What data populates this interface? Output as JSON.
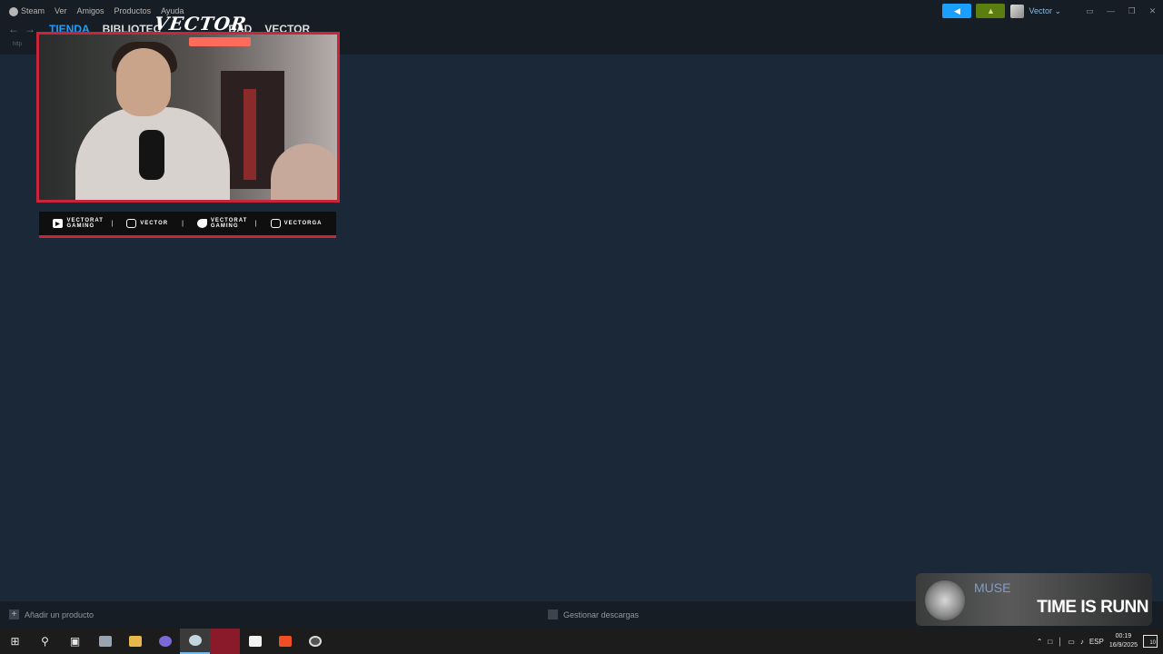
{
  "menu": {
    "items": [
      "Steam",
      "Ver",
      "Amigos",
      "Productos",
      "Ayuda"
    ]
  },
  "nav": {
    "tabs": [
      "TIENDA",
      "BIBLIOTEC",
      "DAD",
      "VECTOR"
    ],
    "url_hint": "http"
  },
  "header_right": {
    "user_name": "Vector",
    "window_controls": [
      "▭",
      "—",
      "❐",
      "✕"
    ]
  },
  "overlay": {
    "logo_text": "VECTOR",
    "socials": [
      {
        "icon": "youtube-icon",
        "label": "VECTORAT GAMING"
      },
      {
        "icon": "twitch-icon",
        "label": "VECTOR"
      },
      {
        "icon": "twitter-icon",
        "label": "VECTORAT GAMING"
      },
      {
        "icon": "instagram-icon",
        "label": "VECTORGA"
      }
    ]
  },
  "footer": {
    "add_product": "Añadir un producto",
    "downloads": "Gestionar descargas"
  },
  "music": {
    "artist": "MUSE",
    "song": "TIME IS RUNN"
  },
  "taskbar": {
    "apps": [
      "start-icon",
      "search-icon",
      "task-view-icon",
      "app-icon",
      "file-explorer-icon",
      "discord-icon",
      "steam-icon",
      "app-red-icon",
      "app-black-icon",
      "brave-icon",
      "app-round-icon"
    ],
    "tray": {
      "language": "ESP",
      "time": "00:19",
      "date": "16/9/2025",
      "notifications": "10"
    }
  },
  "colors": {
    "background": "#1b2838",
    "accent": "#1a9fff",
    "overlay_red": "#c8243a"
  }
}
